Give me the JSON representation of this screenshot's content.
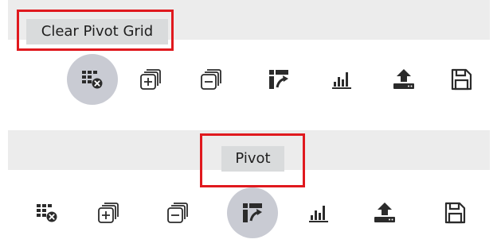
{
  "toolbars": [
    {
      "tooltip": "Clear Pivot Grid",
      "active_button": "clear-pivot-grid-button",
      "buttons": [
        {
          "name": "clear-pivot-grid-button",
          "icon": "table-clear-icon"
        },
        {
          "name": "expand-all-button",
          "icon": "expand-all-icon"
        },
        {
          "name": "collapse-all-button",
          "icon": "collapse-all-icon"
        },
        {
          "name": "pivot-button",
          "icon": "pivot-icon"
        },
        {
          "name": "chart-button",
          "icon": "bar-chart-icon"
        },
        {
          "name": "export-button",
          "icon": "upload-icon"
        },
        {
          "name": "save-button",
          "icon": "floppy-disk-icon"
        }
      ]
    },
    {
      "tooltip": "Pivot",
      "active_button": "pivot-button",
      "buttons": [
        {
          "name": "clear-pivot-grid-button",
          "icon": "table-clear-icon"
        },
        {
          "name": "expand-all-button",
          "icon": "expand-all-icon"
        },
        {
          "name": "collapse-all-button",
          "icon": "collapse-all-icon"
        },
        {
          "name": "pivot-button",
          "icon": "pivot-icon"
        },
        {
          "name": "chart-button",
          "icon": "bar-chart-icon"
        },
        {
          "name": "export-button",
          "icon": "upload-icon"
        },
        {
          "name": "save-button",
          "icon": "floppy-disk-icon"
        }
      ]
    }
  ],
  "colors": {
    "highlight": "#e0191e",
    "tooltip_bg": "#d9dbdc",
    "active_button_bg": "#c9cbd3",
    "icon": "#2b2b2b"
  }
}
